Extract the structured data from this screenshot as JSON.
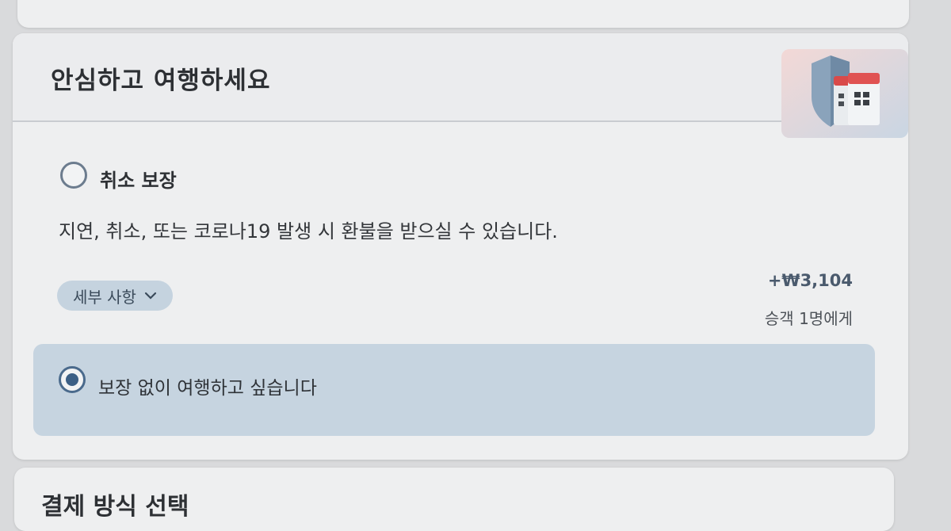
{
  "insurance": {
    "title": "안심하고 여행하세요",
    "option_cancel": {
      "title": "취소 보장",
      "description": "지연, 취소, 또는 코로나19 발생 시 환불을 받으실 수 있습니다.",
      "details_label": "세부 사항",
      "price": "+₩3,104",
      "price_note": "승객 1명에게",
      "selected": false
    },
    "option_none": {
      "label": "보장 없이 여행하고 싶습니다",
      "selected": true
    }
  },
  "payment": {
    "title": "결제 방식 선택"
  },
  "icons": {
    "header_illustration": "shield-calendar-icon",
    "details_chevron": "chevron-down-icon"
  },
  "colors": {
    "accent": "#3c5f85",
    "selected_bg": "#c6d4e0"
  }
}
